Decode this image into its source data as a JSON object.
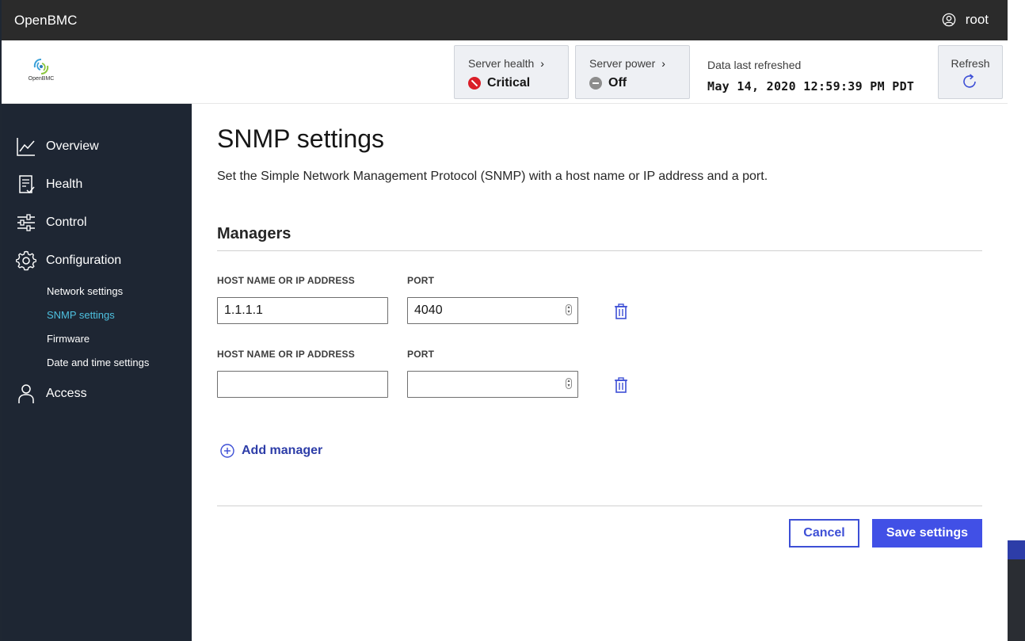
{
  "app": {
    "brand": "OpenBMC",
    "user": "root",
    "logo_text": "OpenBMC"
  },
  "status": {
    "health_label": "Server health",
    "health_value": "Critical",
    "power_label": "Server power",
    "power_value": "Off",
    "refreshed_label": "Data last refreshed",
    "refreshed_value": "May 14, 2020 12:59:39 PM PDT",
    "refresh_label": "Refresh",
    "colors": {
      "critical": "#da1e28",
      "off": "#8d8d8d"
    }
  },
  "sidebar": {
    "items": [
      {
        "label": "Overview",
        "icon": "chart-line-icon"
      },
      {
        "label": "Health",
        "icon": "clipboard-check-icon"
      },
      {
        "label": "Control",
        "icon": "sliders-icon"
      },
      {
        "label": "Configuration",
        "icon": "gear-icon"
      },
      {
        "label": "Access",
        "icon": "user-icon"
      }
    ],
    "sub_items": [
      {
        "label": "Network settings",
        "active": false
      },
      {
        "label": "SNMP settings",
        "active": true
      },
      {
        "label": "Firmware",
        "active": false
      },
      {
        "label": "Date and time settings",
        "active": false
      }
    ]
  },
  "page": {
    "title": "SNMP settings",
    "description": "Set the Simple Network Management Protocol (SNMP) with a host name or IP address and a port.",
    "section_title": "Managers",
    "managers": [
      {
        "host_label": "HOST NAME OR IP ADDRESS",
        "port_label": "PORT",
        "host_value": "1.1.1.1",
        "port_value": "4040"
      },
      {
        "host_label": "HOST NAME OR IP ADDRESS",
        "port_label": "PORT",
        "host_value": "",
        "port_value": ""
      }
    ],
    "add_manager_label": "Add manager",
    "cancel_label": "Cancel",
    "save_label": "Save settings"
  }
}
